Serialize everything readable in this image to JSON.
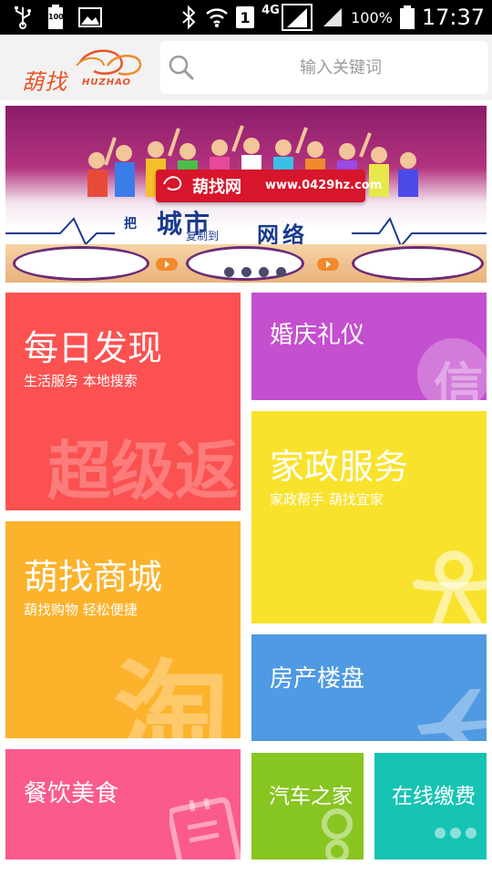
{
  "status_bar": {
    "icons": [
      "usb-icon",
      "battery-saver-icon",
      "gallery-icon",
      "bluetooth-icon",
      "wifi-icon",
      "sim-icon",
      "signal-4g-icon",
      "signal-icon",
      "battery-icon"
    ],
    "battery_small": "100",
    "sim_slot": "1",
    "network": "4G",
    "battery_percent": "100%",
    "time": "17:37"
  },
  "header": {
    "logo_text": "葫找",
    "logo_sub": "HUZHAO",
    "search_placeholder": "输入关键词",
    "search_icon": "search-icon"
  },
  "banner": {
    "site_name": "葫找网",
    "site_url": "www.0429hz.com",
    "slogan_small_1": "把",
    "slogan_big_1": "城市",
    "slogan_small_2": "复制到",
    "slogan_big_2": "网络",
    "active_slide": 1,
    "slide_count": 4
  },
  "tiles": [
    {
      "id": "daily",
      "title": "每日发现",
      "subtitle": "生活服务 本地搜索",
      "bg_text": "超级返",
      "color": "#fb5151"
    },
    {
      "id": "wedding",
      "title": "婚庆礼仪",
      "subtitle": "",
      "bg_text": "信",
      "color": "#c44fcf"
    },
    {
      "id": "housekeeping",
      "title": "家政服务",
      "subtitle": "家政帮手 葫找宜家",
      "color": "#f9e22b"
    },
    {
      "id": "mall",
      "title": "葫找商城",
      "subtitle": "葫找购物 轻松便捷",
      "bg_text": "淘",
      "color": "#fcb22b"
    },
    {
      "id": "realestate",
      "title": "房产楼盘",
      "subtitle": "",
      "color": "#4f9ae2"
    },
    {
      "id": "food",
      "title": "餐饮美食",
      "subtitle": "",
      "color": "#fb5a8c"
    },
    {
      "id": "auto",
      "title": "汽车之家",
      "subtitle": "",
      "color": "#87c520"
    },
    {
      "id": "payment",
      "title": "在线缴费",
      "subtitle": "",
      "color": "#16c3b3"
    }
  ],
  "colors": {
    "header_bg": "#f2f2f2",
    "logo_accent": "#e8542a"
  }
}
